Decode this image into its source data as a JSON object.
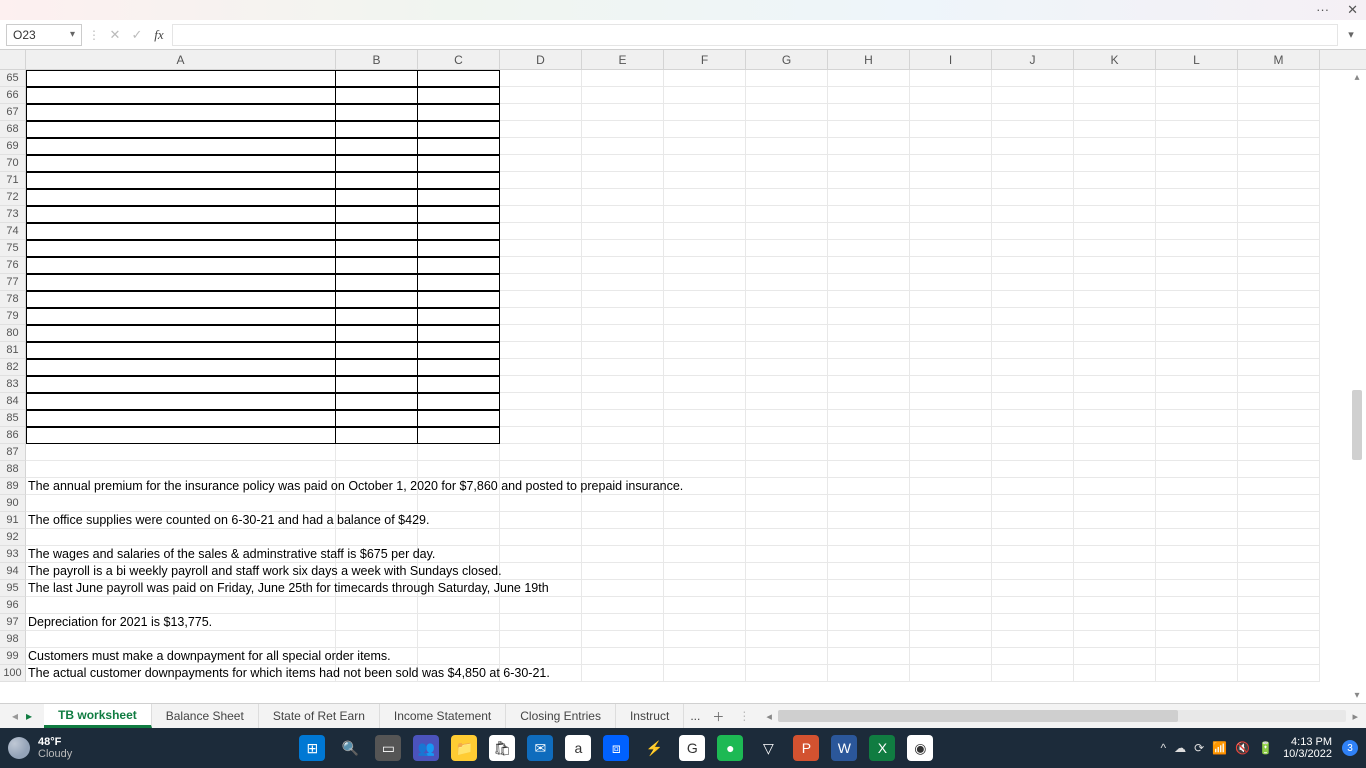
{
  "titlebar": {
    "more": "···",
    "close": "✕"
  },
  "formula": {
    "name_box": "O23",
    "fx": "fx",
    "value": ""
  },
  "columns": [
    "A",
    "B",
    "C",
    "D",
    "E",
    "F",
    "G",
    "H",
    "I",
    "J",
    "K",
    "L",
    "M"
  ],
  "row_start": 65,
  "row_end": 100,
  "bordered_rows_end": 86,
  "text_rows": {
    "89": "The annual premium for the insurance policy was paid on October 1, 2020 for $7,860 and posted to prepaid insurance.",
    "91": "The office supplies were counted on 6-30-21 and had a balance of $429.",
    "93": "The wages and salaries of the sales & adminstrative staff is $675 per day.",
    "94": "The payroll is a bi weekly payroll and staff work six days a week with Sundays closed.",
    "95": "The last June payroll was paid on Friday, June 25th for timecards through Saturday, June 19th",
    "97": "Depreciation for 2021 is $13,775.",
    "99": "Customers must make a downpayment for all special order items.",
    "100": "The actual customer downpayments for which items had not been sold was $4,850 at 6-30-21."
  },
  "sheets": {
    "tabs": [
      "TB worksheet",
      "Balance Sheet",
      "State of Ret Earn",
      "Income Statement",
      "Closing Entries",
      "Instruct"
    ],
    "active": "TB worksheet",
    "more": "...",
    "add": "＋"
  },
  "taskbar": {
    "weather_temp": "48°F",
    "weather_desc": "Cloudy",
    "time": "4:13 PM",
    "date": "10/3/2022",
    "notif_count": "3",
    "apps": [
      {
        "name": "start",
        "bg": "#0078d4",
        "glyph": "⊞"
      },
      {
        "name": "search",
        "bg": "transparent",
        "glyph": "🔍"
      },
      {
        "name": "taskview",
        "bg": "#555",
        "glyph": "▭"
      },
      {
        "name": "teams",
        "bg": "#4b53bc",
        "glyph": "👥"
      },
      {
        "name": "explorer",
        "bg": "#ffcc33",
        "glyph": "📁"
      },
      {
        "name": "store",
        "bg": "#fff",
        "glyph": "🛍"
      },
      {
        "name": "mail",
        "bg": "#0f6cbd",
        "glyph": "✉"
      },
      {
        "name": "amazon",
        "bg": "#fff",
        "glyph": "a"
      },
      {
        "name": "dropbox",
        "bg": "#0061ff",
        "glyph": "⧈"
      },
      {
        "name": "bolt",
        "bg": "transparent",
        "glyph": "⚡"
      },
      {
        "name": "chrome-g",
        "bg": "#fff",
        "glyph": "G"
      },
      {
        "name": "spotify",
        "bg": "#1db954",
        "glyph": "●"
      },
      {
        "name": "brave",
        "bg": "transparent",
        "glyph": "▽"
      },
      {
        "name": "powerpoint",
        "bg": "#d35230",
        "glyph": "P"
      },
      {
        "name": "word",
        "bg": "#2b579a",
        "glyph": "W"
      },
      {
        "name": "excel",
        "bg": "#107c41",
        "glyph": "X"
      },
      {
        "name": "chrome",
        "bg": "#fff",
        "glyph": "◉"
      }
    ],
    "sys": [
      "^",
      "☁",
      "⟳",
      "📶",
      "🔇",
      "🔋"
    ]
  }
}
